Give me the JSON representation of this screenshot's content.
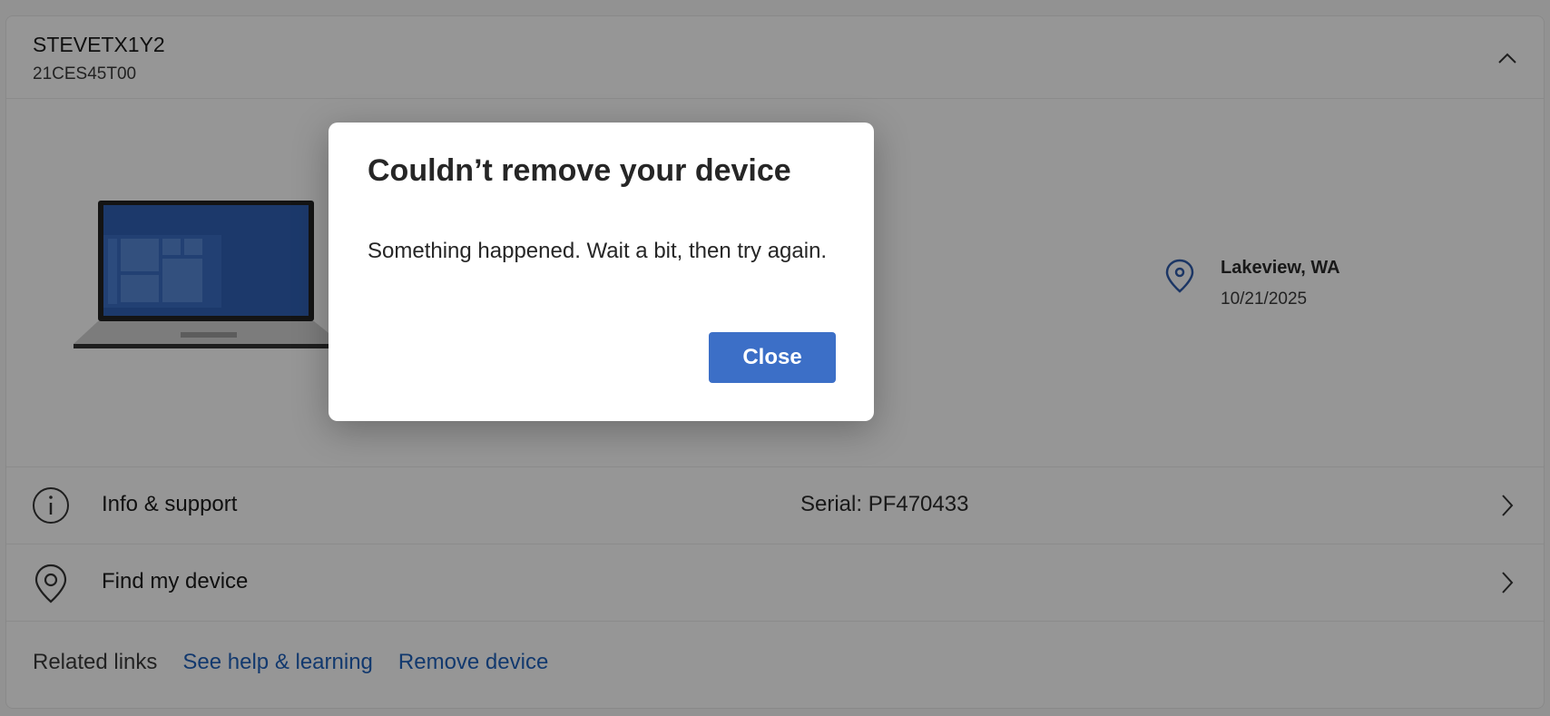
{
  "device": {
    "name": "STEVETX1Y2",
    "model": "21CES45T00"
  },
  "location": {
    "name": "Lakeview, WA",
    "date": "10/21/2025"
  },
  "rows": [
    {
      "label": "Info & support",
      "value": "Serial: PF470433",
      "icon": "info-icon"
    },
    {
      "label": "Find my device",
      "value": "",
      "icon": "location-pin-icon"
    }
  ],
  "related": {
    "title": "Related links",
    "links": [
      "See help & learning",
      "Remove device"
    ]
  },
  "dialog": {
    "title": "Couldn’t remove your device",
    "message": "Something happened. Wait a bit, then try again.",
    "close_label": "Close"
  },
  "colors": {
    "accent": "#3c6fc7",
    "link": "#1f5fb8",
    "icon_blue": "#2f5ba8"
  }
}
